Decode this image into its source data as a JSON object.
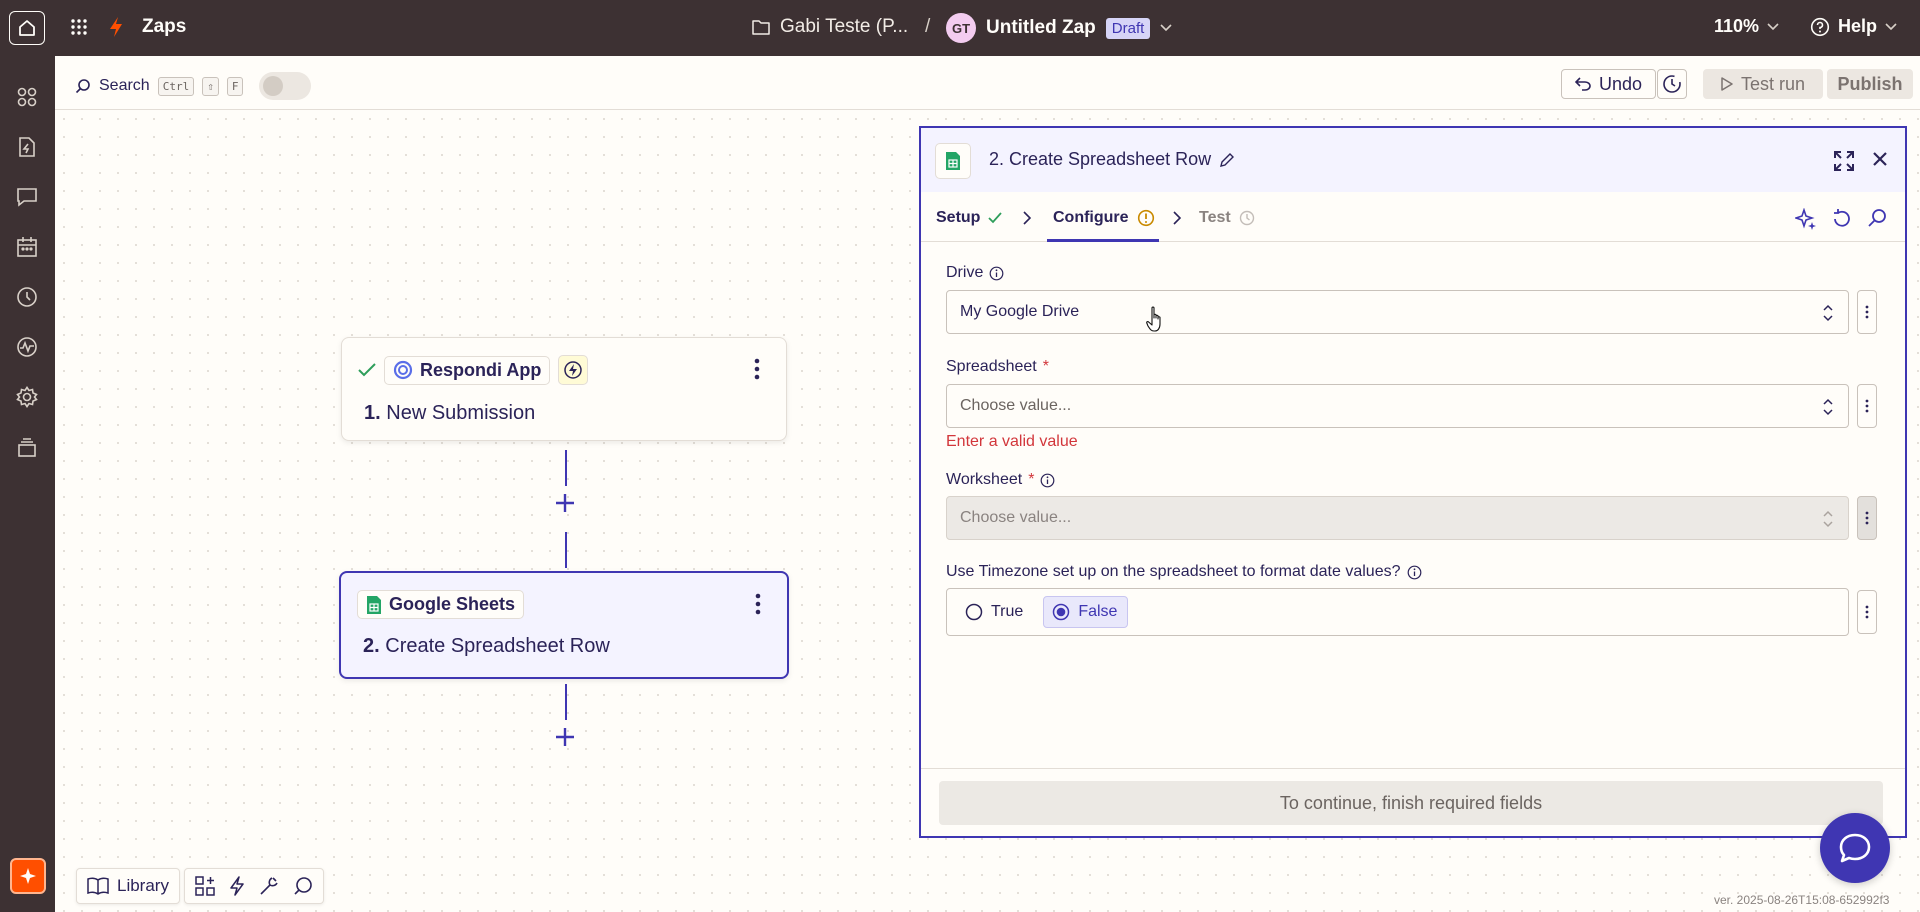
{
  "topbar": {
    "app_name": "Zaps",
    "folder_name": "Gabi Teste (P...",
    "separator": "/",
    "avatar_initials": "GT",
    "zap_name": "Untitled Zap",
    "status_badge": "Draft",
    "zoom": "110%",
    "help_label": "Help"
  },
  "toolbar": {
    "search_label": "Search",
    "shortcut_keys": [
      "Ctrl",
      "⇧",
      "F"
    ],
    "undo_label": "Undo",
    "test_run_label": "Test run",
    "publish_label": "Publish"
  },
  "sidebar_icons": [
    "apps-icon",
    "zap-file-icon",
    "chat-icon",
    "calendar-icon",
    "history-icon",
    "activity-icon",
    "settings-icon",
    "layers-icon"
  ],
  "canvas": {
    "steps": [
      {
        "app": "Respondi App",
        "number": "1.",
        "title": "New Submission"
      },
      {
        "app": "Google Sheets",
        "number": "2.",
        "title": "Create Spreadsheet Row"
      }
    ],
    "library_label": "Library"
  },
  "panel": {
    "title": "2. Create Spreadsheet Row",
    "tabs": [
      {
        "label": "Setup",
        "status": "complete"
      },
      {
        "label": "Configure",
        "status": "warning"
      },
      {
        "label": "Test",
        "status": "pending"
      }
    ],
    "fields": {
      "drive": {
        "label": "Drive",
        "value": "My Google Drive"
      },
      "spreadsheet": {
        "label": "Spreadsheet",
        "required": "*",
        "placeholder": "Choose value...",
        "error": "Enter a valid value"
      },
      "worksheet": {
        "label": "Worksheet",
        "required": "*",
        "placeholder": "Choose value..."
      },
      "timezone": {
        "label": "Use Timezone set up on the spreadsheet to format date values?",
        "options": [
          "True",
          "False"
        ],
        "selected": "False"
      }
    },
    "continue_label": "To continue, finish required fields"
  },
  "version": "ver. 2025-08-26T15:08-652992f3",
  "colors": {
    "chrome": "#3d3133",
    "accent": "#3f36b2",
    "brand_orange": "#ff4f00",
    "success": "#2e9e5b",
    "warning": "#c98a00",
    "error": "#d2363b",
    "canvas_bg": "#fffdf9"
  }
}
